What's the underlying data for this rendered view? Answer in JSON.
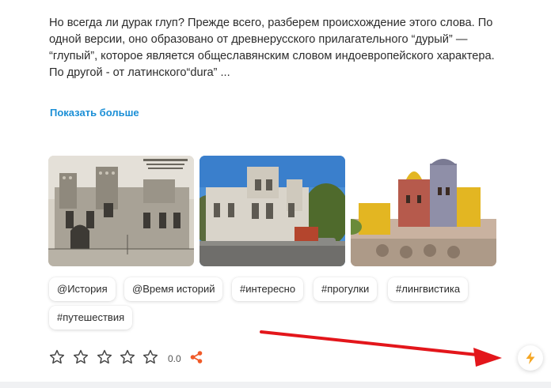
{
  "article": {
    "lines": [
      "Но всегда ли дурак глуп? Прежде всего, разберем происхождение этого слова. По",
      "одной версии, оно образовано от древнерусского прилагательного “дурый” —",
      "“глупый”, которое является общеславянским словом индоевропейского характера.",
      "По другой - от латинского“dura” ..."
    ],
    "show_more_label": "Показать больше"
  },
  "tags": [
    "@История",
    "@Время историй",
    "#интересно",
    "#прогулки",
    "#лингвистика",
    "#путешествия"
  ],
  "rating": {
    "stars_total": 5,
    "stars_filled": 0,
    "value": "0.0"
  },
  "icons": {
    "star": "star-outline-icon",
    "share": "share-icon",
    "bolt": "lightning-bolt-icon"
  },
  "colors": {
    "link": "#1b8fd6",
    "share": "#f05a28",
    "bolt": "#f5a623",
    "annotation_arrow": "#e3161b"
  }
}
